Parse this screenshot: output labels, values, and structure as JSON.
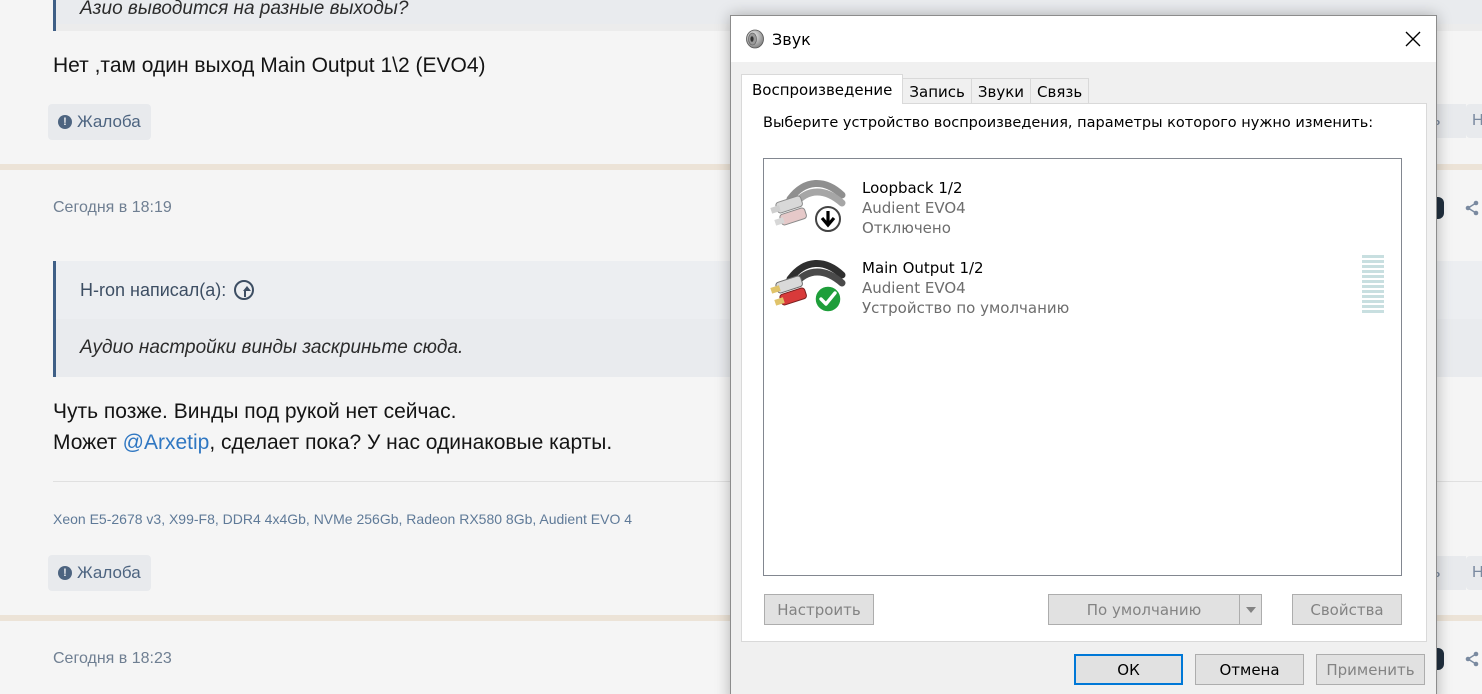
{
  "forum": {
    "top_quote_partial": "Азио выводится на разные выходы?",
    "reply_1": "Нет ,там один выход Main Output 1\\2 (EVO4)",
    "report_label": "Жалоба",
    "post_2": {
      "date": "Сегодня в 18:19",
      "quote_author": "H-ron написал(а):",
      "quote_text": "Аудио настройки винды заскриньте сюда.",
      "line_1": "Чуть позже. Винды под рукой нет сейчас.",
      "line_2_before": "Может ",
      "mention": "@Arxetip",
      "line_2_after": ", сделает пока? У нас одинаковые карты.",
      "signature": "Xeon E5-2678 v3, X99-F8, DDR4 4x4Gb, NVMe 256Gb, Radeon RX580 8Gb, Audient EVO 4"
    },
    "post_3": {
      "date": "Сегодня в 18:23"
    },
    "right_fragment_1": "ь",
    "right_fragment_2": "Н"
  },
  "dialog": {
    "title": "Звук",
    "tabs": [
      {
        "label": "Воспроизведение",
        "active": true
      },
      {
        "label": "Запись",
        "active": false
      },
      {
        "label": "Звуки",
        "active": false
      },
      {
        "label": "Связь",
        "active": false
      }
    ],
    "prompt": "Выберите устройство воспроизведения, параметры которого нужно изменить:",
    "devices": [
      {
        "name": "Loopback 1/2",
        "driver": "Audient EVO4",
        "status": "Отключено",
        "badge": "down-arrow-disabled"
      },
      {
        "name": "Main Output 1/2",
        "driver": "Audient EVO4",
        "status": "Устройство по умолчанию",
        "badge": "green-check-default"
      }
    ],
    "buttons": {
      "configure": "Настроить",
      "set_default": "По умолчанию",
      "properties": "Свойства",
      "ok": "ОК",
      "cancel": "Отмена",
      "apply": "Применить"
    },
    "colors": {
      "accent": "#0078d7",
      "default_badge": "#1e9e3a",
      "meter": "#c8dfe0"
    }
  }
}
